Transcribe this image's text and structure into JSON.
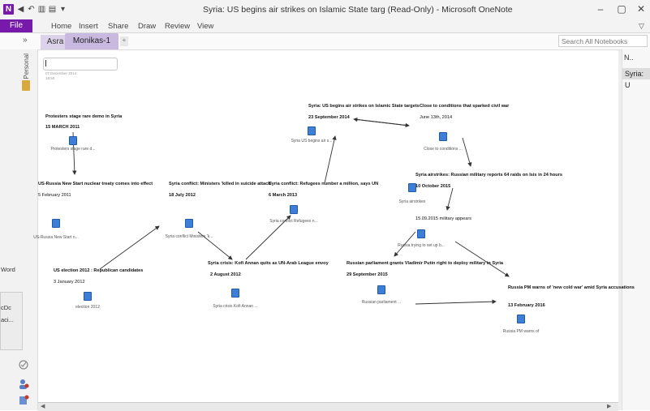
{
  "window": {
    "title": "Syria: US begins air strikes on Islamic State targ (Read-Only) - Microsoft OneNote",
    "app_icon": "N",
    "controls": [
      "–",
      "▢",
      "✕"
    ]
  },
  "ribbon": {
    "file": "File",
    "tabs": [
      "Home",
      "Insert",
      "Share",
      "Draw",
      "Review",
      "View"
    ]
  },
  "notebook": {
    "sections": [
      "Asra",
      "Monikas-1"
    ],
    "search_placeholder": "Search All Notebooks (Ctrl+E)",
    "nav_label": "Personal",
    "expand": "»"
  },
  "page": {
    "date": "07 December 2014",
    "time": "18:50"
  },
  "pages_panel": {
    "new_page": "N..",
    "current": "Syria: U"
  },
  "behind_window": {
    "word": "Word",
    "line1": "cDc",
    "line2": "aci..."
  },
  "timeline": [
    {
      "headline": "Protesters stage rare demo in Syria",
      "date": "15 MARCH 2011",
      "caption": "Protesters stage rare d..."
    },
    {
      "headline": "US-Russia New Start nuclear treaty comes into effect",
      "date": "5 February 2011",
      "caption": "US-Russia New Start n..."
    },
    {
      "headline": "US election 2012 : Republican candidates",
      "date": "3 January 2012",
      "caption": "election 2012"
    },
    {
      "headline": "Syria conflict: Ministers 'killed in suicide attack'",
      "date": "18 July 2012",
      "caption": "Syria conflict Ministers 'k..."
    },
    {
      "headline": "Syria crisis: Kofi Annan quits as UN-Arab League envoy",
      "date": "2 August 2012",
      "caption": "Syria crisis Kofi Annan ..."
    },
    {
      "headline": "Syria conflict: Refugees number a million, says UN",
      "date": "6 March 2013",
      "caption": "Syria conflict Refugees n..."
    },
    {
      "headline": "Syria: US begins air strikes on Islamic State targets",
      "date": "23 September 2014",
      "caption": "Syria US begins air s..."
    },
    {
      "headline": "Close to conditions that sparked civil war",
      "date": "June 13th, 2014",
      "caption": "Close to conditions ..."
    },
    {
      "headline": "Syria airstrikes: Russian military reports 64 raids on Isis in 24 hours",
      "date": "10 October 2015",
      "caption": "Syria airstrikes"
    },
    {
      "headline": "15.09.2015 military appears",
      "date": "",
      "caption": "Russia trying to set up b..."
    },
    {
      "headline": "Russian parliament grants Vladimir Putin right to deploy military in Syria",
      "date": "29 September 2015",
      "caption": "Russian parliament ..."
    },
    {
      "headline": "Russia PM warns of 'new cold war' amid Syria accusations",
      "date": "13 February 2016",
      "caption": "Russia PM warns of"
    }
  ]
}
